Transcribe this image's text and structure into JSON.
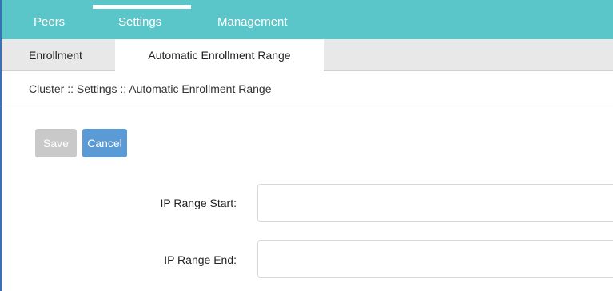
{
  "topnav": {
    "tabs": [
      {
        "label": "Peers"
      },
      {
        "label": "Settings",
        "active": true
      },
      {
        "label": "Management"
      }
    ]
  },
  "subtabs": [
    {
      "label": "Enrollment"
    },
    {
      "label": "Automatic Enrollment Range",
      "active": true
    }
  ],
  "breadcrumb": "Cluster :: Settings :: Automatic Enrollment Range",
  "toolbar": {
    "save_label": "Save",
    "cancel_label": "Cancel"
  },
  "form": {
    "ip_range_start": {
      "label": "IP Range Start:",
      "value": ""
    },
    "ip_range_end": {
      "label": "IP Range End:",
      "value": ""
    }
  },
  "colors": {
    "nav_bg": "#5bc6c9",
    "cancel_button": "#5b9bd5",
    "save_button_disabled": "#c9c9c9"
  }
}
